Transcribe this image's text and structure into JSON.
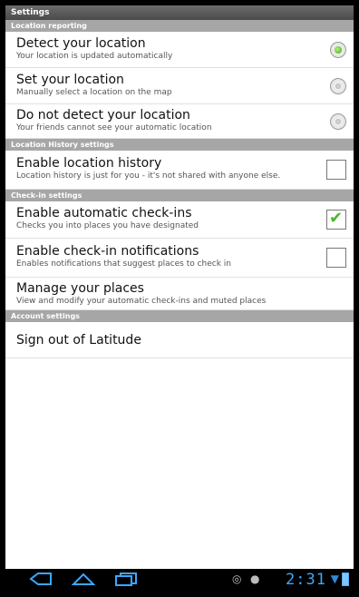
{
  "window": {
    "title": "Settings"
  },
  "sections": [
    {
      "header": "Location reporting"
    },
    {
      "header": "Location History settings"
    },
    {
      "header": "Check-in settings"
    },
    {
      "header": "Account settings"
    }
  ],
  "location_reporting": {
    "detect": {
      "title": "Detect your location",
      "summary": "Your location is updated automatically",
      "selected": true
    },
    "set": {
      "title": "Set your location",
      "summary": "Manually select a location on the map",
      "selected": false
    },
    "dont_detect": {
      "title": "Do not detect your location",
      "summary": "Your friends cannot see your automatic location",
      "selected": false
    }
  },
  "history": {
    "enable": {
      "title": "Enable location history",
      "summary": "Location history is just for you - it's not shared with anyone else.",
      "checked": false
    }
  },
  "checkins": {
    "auto": {
      "title": "Enable automatic check-ins",
      "summary": "Checks you into places you have designated",
      "checked": true
    },
    "notifications": {
      "title": "Enable check-in notifications",
      "summary": "Enables notifications that suggest places to check in",
      "checked": false
    },
    "manage": {
      "title": "Manage your places",
      "summary": "View and modify your automatic check-ins and muted places"
    }
  },
  "account": {
    "sign_out": {
      "title": "Sign out of Latitude"
    }
  },
  "statusbar": {
    "time": "2:31",
    "icons": [
      "back-icon",
      "home-icon",
      "recent-apps-icon",
      "location-icon",
      "android-icon",
      "wifi-icon",
      "battery-icon"
    ]
  },
  "colors": {
    "accent": "#3aa9ff",
    "check": "#4bb82a",
    "radio_on": "#5cbf2a",
    "section_header": "#a6a6a6"
  }
}
